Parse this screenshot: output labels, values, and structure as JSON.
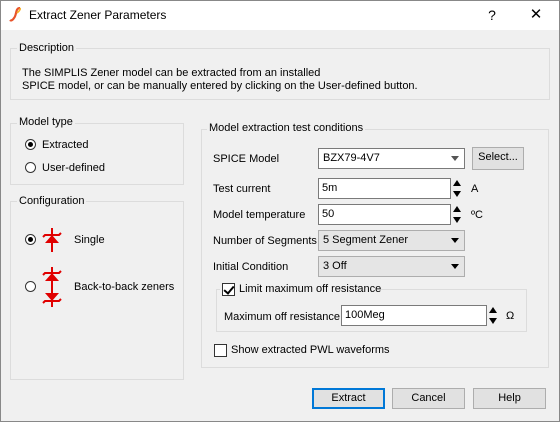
{
  "window": {
    "title": "Extract Zener Parameters",
    "help_glyph": "?",
    "close_glyph": "✕"
  },
  "description": {
    "title": "Description",
    "line1": "The SIMPLIS Zener model can be extracted from an installed",
    "line2": "SPICE model, or can be manually entered by clicking on the User-defined button."
  },
  "model_type": {
    "title": "Model type",
    "options": [
      {
        "label": "Extracted",
        "selected": true
      },
      {
        "label": "User-defined",
        "selected": false
      }
    ]
  },
  "configuration": {
    "title": "Configuration",
    "options": [
      {
        "label": "Single",
        "selected": true,
        "icon": "zener-diode-icon"
      },
      {
        "label": "Back-to-back zeners",
        "selected": false,
        "icon": "back-to-back-zener-icon"
      }
    ],
    "icon_color": "#e00000"
  },
  "extraction": {
    "title": "Model extraction test conditions",
    "spice_model": {
      "label": "SPICE Model",
      "value": "BZX79-4V7",
      "select_button": "Select..."
    },
    "test_current": {
      "label": "Test current",
      "value": "5m",
      "unit": "A"
    },
    "model_temperature": {
      "label": "Model temperature",
      "value": "50",
      "unit": "ºC"
    },
    "segments": {
      "label": "Number of Segments",
      "value": "5 Segment Zener"
    },
    "initial_condition": {
      "label": "Initial Condition",
      "value": "3 Off"
    },
    "limit_off_resistance": {
      "label": "Limit maximum off resistance",
      "checked": true,
      "max_off_label": "Maximum off resistance",
      "max_off_value": "100Meg",
      "unit": "Ω"
    },
    "show_pwl": {
      "label": "Show extracted PWL waveforms",
      "checked": false
    }
  },
  "buttons": {
    "extract": "Extract",
    "cancel": "Cancel",
    "help": "Help"
  },
  "colors": {
    "accent": "#0078d7",
    "titlebar": "#ffffff",
    "background": "#f0f0f0"
  }
}
